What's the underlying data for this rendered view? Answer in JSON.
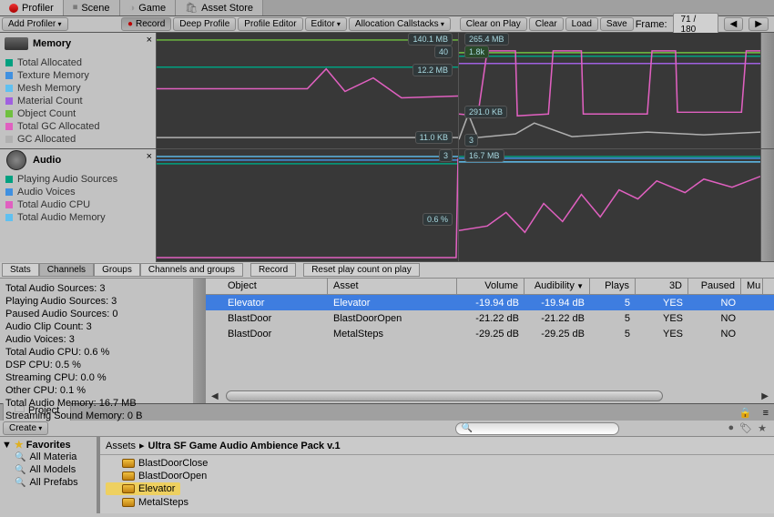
{
  "tabs": {
    "profiler": "Profiler",
    "scene": "Scene",
    "game": "Game",
    "assetstore": "Asset Store"
  },
  "toolbar": {
    "addProfiler": "Add Profiler",
    "record": "Record",
    "deepProfile": "Deep Profile",
    "profileEditor": "Profile Editor",
    "editor": "Editor",
    "allocCallstacks": "Allocation Callstacks",
    "clearOnPlay": "Clear on Play",
    "clear": "Clear",
    "load": "Load",
    "save": "Save",
    "frameLabel": "Frame:",
    "frameValue": "71 / 180"
  },
  "memory": {
    "title": "Memory",
    "legend": [
      {
        "label": "Total Allocated",
        "color": "#00a080"
      },
      {
        "label": "Texture Memory",
        "color": "#4090e0"
      },
      {
        "label": "Mesh Memory",
        "color": "#60c0f0"
      },
      {
        "label": "Material Count",
        "color": "#a060e0"
      },
      {
        "label": "Object Count",
        "color": "#70c040"
      },
      {
        "label": "Total GC Allocated",
        "color": "#e060c0"
      },
      {
        "label": "GC Allocated",
        "color": "#b0b0b0"
      }
    ],
    "badges": [
      "140.1 MB",
      "40",
      "265.4 MB",
      "1.8k",
      "12.2 MB",
      "291.0 KB",
      "11.0 KB",
      "3"
    ]
  },
  "audio": {
    "title": "Audio",
    "legend": [
      {
        "label": "Playing Audio Sources",
        "color": "#00a080"
      },
      {
        "label": "Audio Voices",
        "color": "#4090e0"
      },
      {
        "label": "Total Audio CPU",
        "color": "#e060c0"
      },
      {
        "label": "Total Audio Memory",
        "color": "#60c0f0"
      }
    ],
    "badges": [
      "16.7 MB",
      "0.6 %"
    ]
  },
  "dtabs": [
    "Stats",
    "Channels",
    "Groups",
    "Channels and groups",
    "Record",
    "Reset play count on play"
  ],
  "stats": [
    "Total Audio Sources: 3",
    "Playing Audio Sources: 3",
    "Paused Audio Sources: 0",
    "Audio Clip Count: 3",
    "Audio Voices: 3",
    "Total Audio CPU: 0.6 %",
    "DSP CPU: 0.5 %",
    "Streaming CPU: 0.0 %",
    "Other CPU: 0.1 %",
    "Total Audio Memory: 16.7 MB",
    "Streaming Sound Memory: 0 B"
  ],
  "table": {
    "headers": [
      "Object",
      "Asset",
      "Volume",
      "Audibility",
      "Plays",
      "3D",
      "Paused",
      "Mu"
    ],
    "rows": [
      {
        "obj": "Elevator",
        "asset": "Elevator",
        "vol": "-19.94 dB",
        "aud": "-19.94 dB",
        "plays": "5",
        "td": "YES",
        "paused": "NO",
        "sel": true
      },
      {
        "obj": "BlastDoor",
        "asset": "BlastDoorOpen",
        "vol": "-21.22 dB",
        "aud": "-21.22 dB",
        "plays": "5",
        "td": "YES",
        "paused": "NO"
      },
      {
        "obj": "BlastDoor",
        "asset": "MetalSteps",
        "vol": "-29.25 dB",
        "aud": "-29.25 dB",
        "plays": "5",
        "td": "YES",
        "paused": "NO"
      }
    ]
  },
  "project": {
    "tab": "Project",
    "create": "Create",
    "favorites": "Favorites",
    "favitems": [
      "All Materia",
      "All Models",
      "All Prefabs"
    ],
    "crumb": [
      "Assets",
      "Ultra SF Game Audio Ambience Pack v.1"
    ],
    "assets": [
      "BlastDoorClose",
      "BlastDoorOpen",
      "Elevator",
      "MetalSteps"
    ]
  }
}
